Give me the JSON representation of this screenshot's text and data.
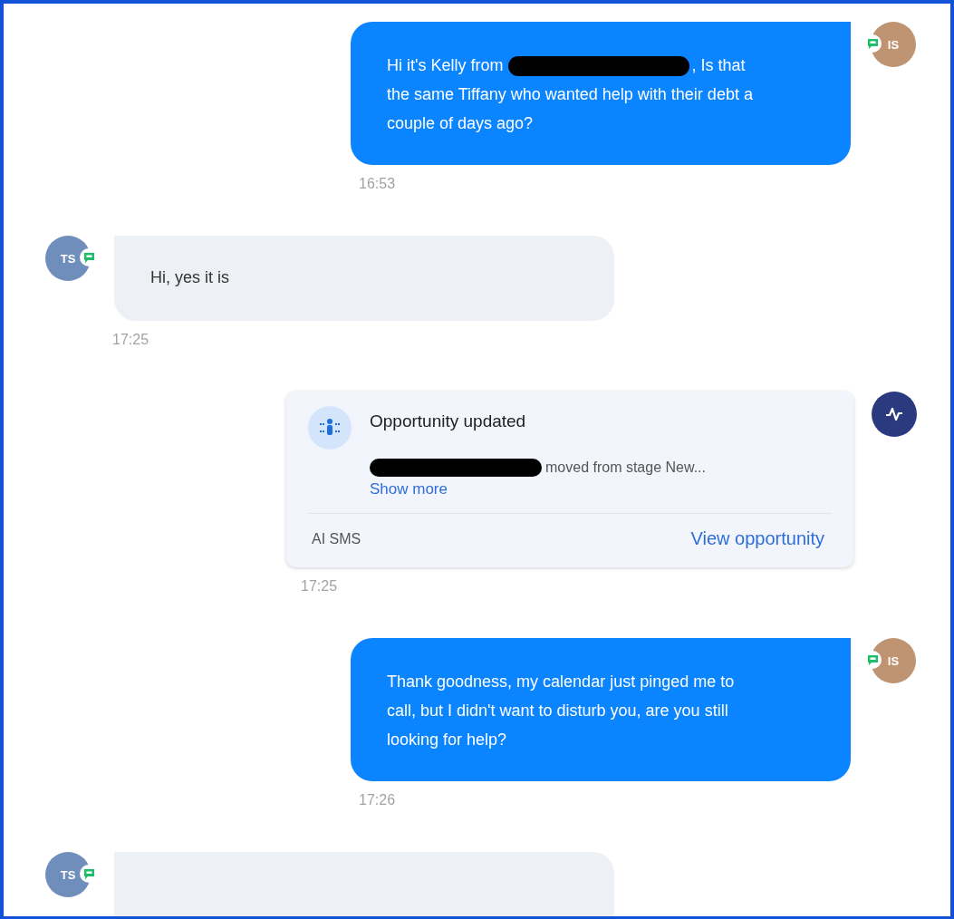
{
  "messages": [
    {
      "kind": "outgoing",
      "avatar": {
        "initials": "IS"
      },
      "text_before": "Hi it's Kelly from",
      "redacted": true,
      "text_after": ", Is that the same Tiffany who wanted help with their debt a couple of days ago?",
      "time": "16:53"
    },
    {
      "kind": "incoming",
      "avatar": {
        "initials": "TS"
      },
      "text_before": "Hi, yes it is",
      "time": "17:25"
    },
    {
      "kind": "activity",
      "title": "Opportunity updated",
      "redacted": true,
      "detail": "moved from stage New...",
      "link": "Show more",
      "source": "AI SMS",
      "action": "View opportunity",
      "time": "17:25"
    },
    {
      "kind": "outgoing",
      "avatar": {
        "initials": "IS"
      },
      "text_before": "Thank goodness, my calendar just pinged me to call, but I didn't want to disturb you, are you still looking for help?",
      "time": "17:26"
    },
    {
      "kind": "incoming",
      "avatar": {
        "initials": "TS"
      }
    }
  ]
}
